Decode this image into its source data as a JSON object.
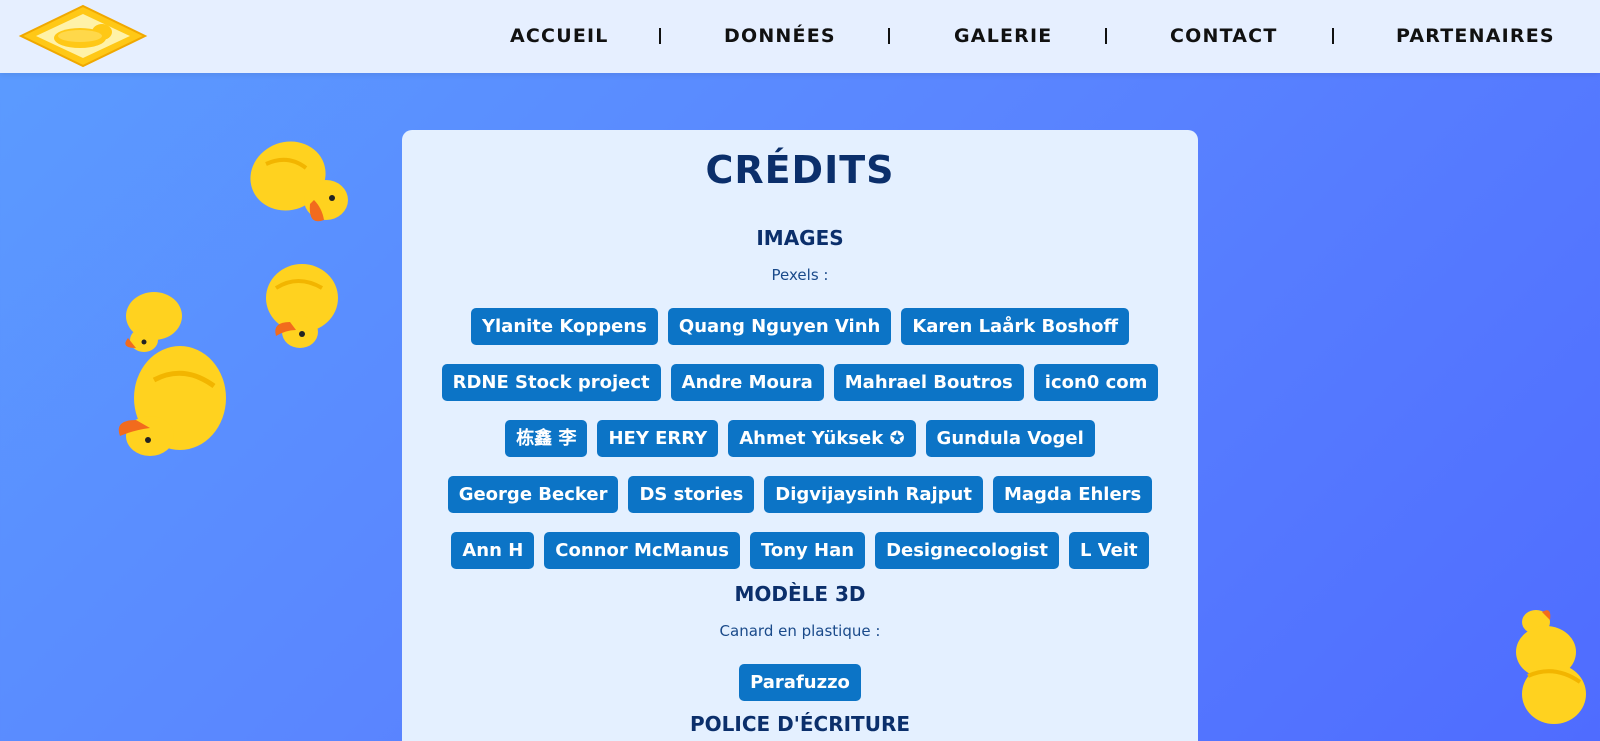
{
  "nav": {
    "items": [
      {
        "label": "ACCUEIL"
      },
      {
        "label": "DONNÉES"
      },
      {
        "label": "GALERIE"
      },
      {
        "label": "CONTACT"
      },
      {
        "label": "PARTENAIRES"
      }
    ]
  },
  "credits": {
    "title": "CRÉDITS",
    "images": {
      "heading": "IMAGES",
      "source_label": "Pexels :",
      "rows": [
        [
          "Ylanite Koppens",
          "Quang Nguyen Vinh",
          "Karen Laårk Boshoff"
        ],
        [
          "RDNE Stock project",
          "Andre Moura",
          "Mahrael Boutros",
          "icon0 com"
        ],
        [
          "栋鑫 李",
          "HEY ERRY",
          "Ahmet Yüksek ✪",
          "Gundula Vogel"
        ],
        [
          "George Becker",
          "DS stories",
          "Digvijaysinh Rajput",
          "Magda Ehlers"
        ],
        [
          "Ann H",
          "Connor McManus",
          "Tony Han",
          "Designecologist",
          "L Veit"
        ]
      ]
    },
    "model": {
      "heading": "MODÈLE 3D",
      "source_label": "Canard en plastique :",
      "authors": [
        "Parafuzzo"
      ]
    },
    "font": {
      "heading": "POLICE D'ÉCRITURE"
    }
  },
  "colors": {
    "header_bg": "#e6efff",
    "card_bg": "#e4f0ff",
    "tag_bg": "#0c74c6",
    "heading": "#0b2f6b",
    "duck_yellow": "#ffd21f",
    "duck_beak": "#f26b1d"
  },
  "icons": [
    "rubber-duck-logo-icon",
    "rubber-duck-icon"
  ]
}
